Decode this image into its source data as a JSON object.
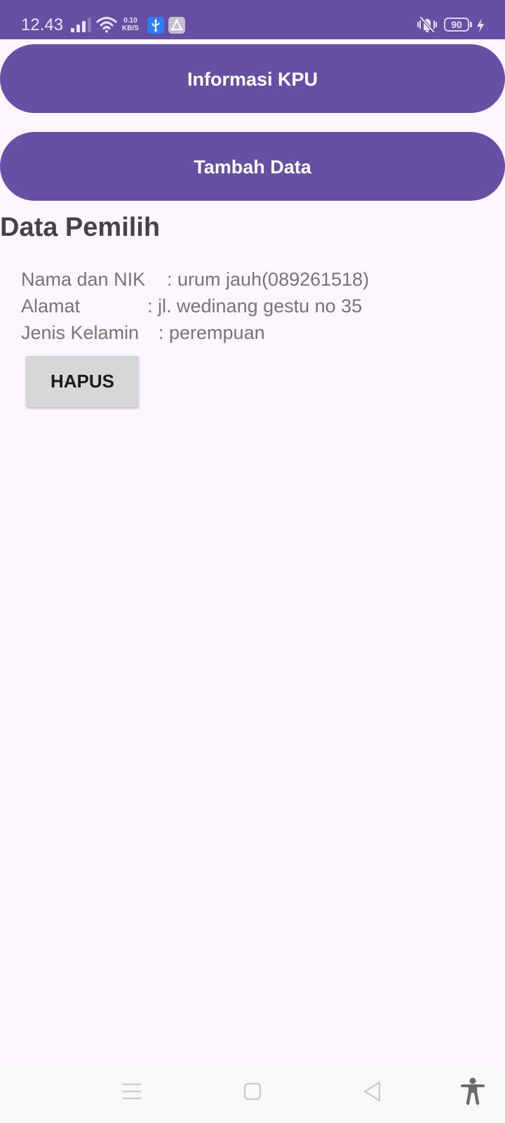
{
  "status_bar": {
    "time": "12.43",
    "net_speed_value": "0.10",
    "net_speed_unit": "KB/S",
    "battery": "90",
    "icons": [
      "signal-icon",
      "wifi-icon",
      "usb-icon",
      "app-notification-icon",
      "vibrate-off-icon",
      "battery-icon",
      "charging-icon"
    ]
  },
  "buttons": {
    "info_label": "Informasi KPU",
    "add_label": "Tambah Data"
  },
  "section": {
    "title": "Data Pemilih"
  },
  "record": {
    "name_label": "Nama dan NIK",
    "name_value": ": urum jauh(089261518)",
    "address_label": "Alamat",
    "address_value": ": jl. wedinang gestu no 35",
    "gender_label": "Jenis Kelamin",
    "gender_value": ": perempuan",
    "delete_label": "HAPUS"
  },
  "nav_bar": {
    "icons": [
      "menu-icon",
      "home-icon",
      "back-icon",
      "accessibility-icon"
    ]
  },
  "colors": {
    "primary": "#6750a4",
    "background": "#fdf7fd",
    "text_muted": "#757575",
    "title": "#464249",
    "delete_button": "#d6d7d7"
  }
}
